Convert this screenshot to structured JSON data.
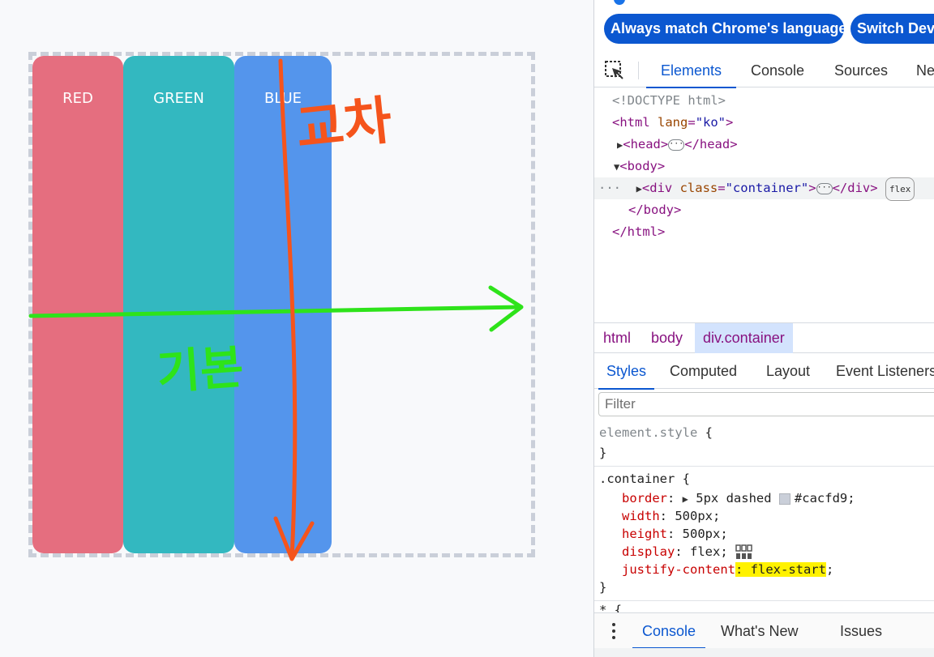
{
  "page": {
    "items": [
      {
        "label": "RED",
        "color": "#e56e7f"
      },
      {
        "label": "GREEN",
        "color": "#33b8c0"
      },
      {
        "label": "BLUE",
        "color": "#5495ec"
      }
    ],
    "container_border_color": "#cacfd9",
    "annotations": {
      "main_axis_label": "기본",
      "main_axis_color": "#2ee31a",
      "cross_axis_label": "교차",
      "cross_axis_color": "#f5541c"
    }
  },
  "devtools": {
    "lang_buttons": [
      "Always match Chrome's language",
      "Switch DevTools"
    ],
    "tabs": [
      "Elements",
      "Console",
      "Sources",
      "Network"
    ],
    "active_tab": "Elements",
    "dom": {
      "doctype": "<!DOCTYPE html>",
      "html_open_tag": "<html",
      "html_lang_attr": "lang",
      "html_lang_val": "\"ko\"",
      "html_close_bracket": ">",
      "head_open": "<head>",
      "head_close": "</head>",
      "body_open": "<body>",
      "div_open": "<div",
      "div_class_attr": "class",
      "div_class_val": "\"container\"",
      "div_close_bracket": ">",
      "div_close": "</div>",
      "flex_badge": "flex",
      "body_close": "</body>",
      "html_close": "</html>",
      "ellipsis": "···",
      "row_dots": "···"
    },
    "breadcrumbs": [
      "html",
      "body",
      "div.container"
    ],
    "subtabs": [
      "Styles",
      "Computed",
      "Layout",
      "Event Listeners"
    ],
    "active_subtab": "Styles",
    "filter_placeholder": "Filter",
    "styles": {
      "element_style_selector": "element.style",
      "open_brace": "{",
      "close_brace": "}",
      "container_selector": ".container",
      "rules": [
        {
          "prop": "border",
          "value": "5px dashed",
          "color_value": "#cacfd9"
        },
        {
          "prop": "width",
          "value": "500px"
        },
        {
          "prop": "height",
          "value": "500px"
        },
        {
          "prop": "display",
          "value": "flex"
        },
        {
          "prop": "justify-content",
          "value": "flex-start"
        }
      ],
      "next_selector": "* {"
    },
    "drawer_tabs": [
      "Console",
      "What's New",
      "Issues"
    ],
    "active_drawer_tab": "Console"
  }
}
